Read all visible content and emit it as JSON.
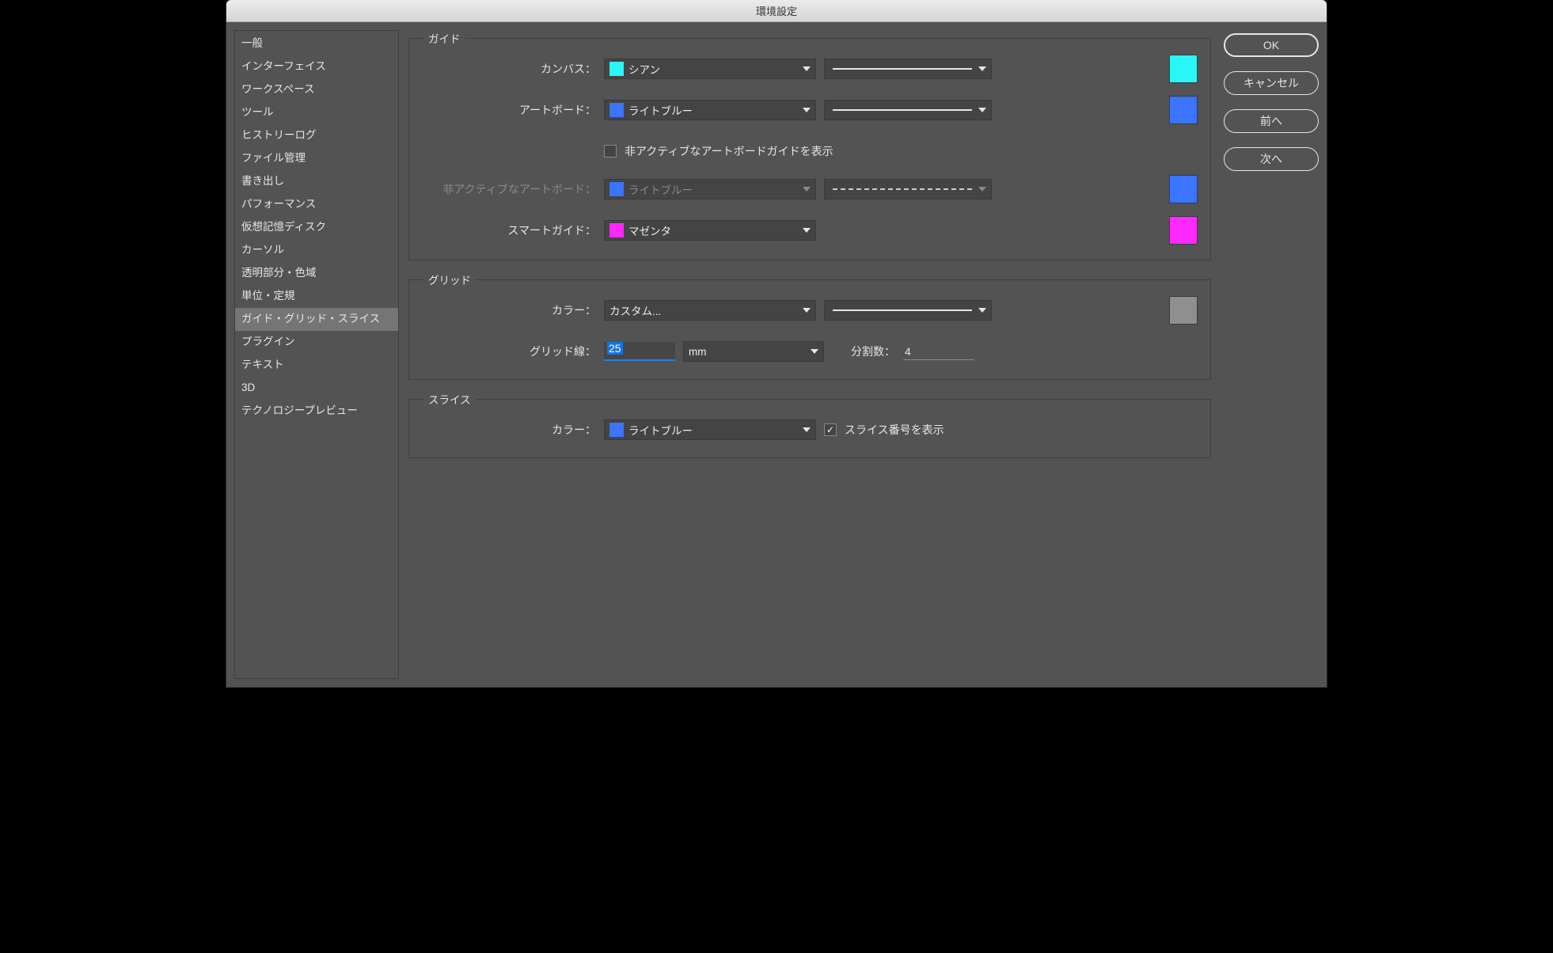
{
  "window": {
    "title": "環境設定"
  },
  "sidebar": {
    "items": [
      {
        "label": "一般"
      },
      {
        "label": "インターフェイス"
      },
      {
        "label": "ワークスペース"
      },
      {
        "label": "ツール"
      },
      {
        "label": "ヒストリーログ"
      },
      {
        "label": "ファイル管理"
      },
      {
        "label": "書き出し"
      },
      {
        "label": "パフォーマンス"
      },
      {
        "label": "仮想記憶ディスク"
      },
      {
        "label": "カーソル"
      },
      {
        "label": "透明部分・色域"
      },
      {
        "label": "単位・定規"
      },
      {
        "label": "ガイド・グリッド・スライス"
      },
      {
        "label": "プラグイン"
      },
      {
        "label": "テキスト"
      },
      {
        "label": "3D"
      },
      {
        "label": "テクノロジープレビュー"
      }
    ],
    "selected_index": 12
  },
  "buttons": {
    "ok": "OK",
    "cancel": "キャンセル",
    "prev": "前へ",
    "next": "次へ"
  },
  "groups": {
    "guides": {
      "legend": "ガイド",
      "canvas_label": "カンバス：",
      "canvas_color_name": "シアン",
      "canvas_color_hex": "#29f7f7",
      "artboard_label": "アートボード：",
      "artboard_color_name": "ライトブルー",
      "artboard_color_hex": "#3a74ff",
      "show_inactive_checkbox_label": "非アクティブなアートボードガイドを表示",
      "inactive_label": "非アクティブなアートボード：",
      "inactive_color_name": "ライトブルー",
      "inactive_color_hex": "#3a74ff",
      "smart_label": "スマートガイド：",
      "smart_color_name": "マゼンタ",
      "smart_color_hex": "#ff29ff"
    },
    "grid": {
      "legend": "グリッド",
      "color_label": "カラー：",
      "color_name": "カスタム...",
      "swatch_hex": "#8f8f8f",
      "gridline_label": "グリッド線：",
      "gridline_value": "25",
      "gridline_unit": "mm",
      "subdivision_label": "分割数：",
      "subdivision_value": "4"
    },
    "slices": {
      "legend": "スライス",
      "color_label": "カラー：",
      "color_name": "ライトブルー",
      "color_hex": "#3a74ff",
      "show_numbers_label": "スライス番号を表示"
    }
  }
}
